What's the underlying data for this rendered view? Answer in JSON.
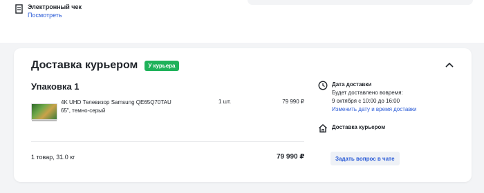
{
  "receipt": {
    "icon": "receipt-document-icon",
    "title": "Электронный чек",
    "link": "Посмотреть"
  },
  "delivery": {
    "title": "Доставка курьером",
    "badge": "У курьера",
    "badge_color": "#1fb25a",
    "collapse_icon": "chevron-up-icon",
    "package_title": "Упаковка 1",
    "item": {
      "name": "4K UHD Телевизор Samsung QE65Q70TAU 65\", темно-серый",
      "qty": "1 шт.",
      "price": "79 990 ₽"
    },
    "summary": "1 товар, 31.0 кг",
    "total": "79 990 ₽",
    "date_block": {
      "icon": "clock-icon",
      "title": "Дата доставки",
      "line1": "Будет доставлено вовремя:",
      "line2": "9 октября с 10:00 до 16:00",
      "link": "Изменить дату и время доставки"
    },
    "courier_block": {
      "icon": "home-icon",
      "title": "Доставка курьером"
    },
    "chat_button": "Задать вопрос в чате",
    "link_color": "#2a5bd7"
  }
}
